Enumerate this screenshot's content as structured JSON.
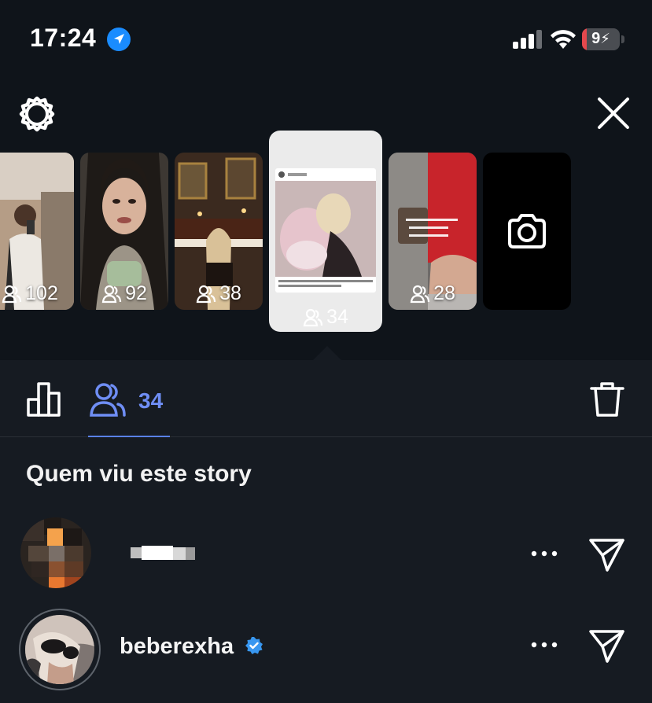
{
  "status_bar": {
    "time": "17:24",
    "battery": "9",
    "battery_level": 0.09,
    "icons": [
      "location-arrow-icon",
      "cellular-signal-icon",
      "wifi-icon",
      "battery-charging-icon"
    ]
  },
  "header": {
    "settings_icon": "gear-icon",
    "close_icon": "close-icon"
  },
  "stories": [
    {
      "viewers": "102"
    },
    {
      "viewers": "92"
    },
    {
      "viewers": "38"
    },
    {
      "viewers": "34",
      "selected": true
    },
    {
      "viewers": "28"
    }
  ],
  "camera_icon": "camera-icon",
  "tabs": {
    "insights_icon": "bar-chart-icon",
    "viewers_icon": "people-icon",
    "viewers_count": "34",
    "delete_icon": "trash-icon"
  },
  "section_title": "Quem viu este story",
  "viewers": [
    {
      "username": "",
      "verified": false
    },
    {
      "username": "beberexha",
      "verified": true
    }
  ],
  "colors": {
    "background": "#0f141a",
    "sheet": "#161b22",
    "accent": "#6f8ef5",
    "verified": "#3897f0",
    "battery_low": "#e5484d"
  }
}
